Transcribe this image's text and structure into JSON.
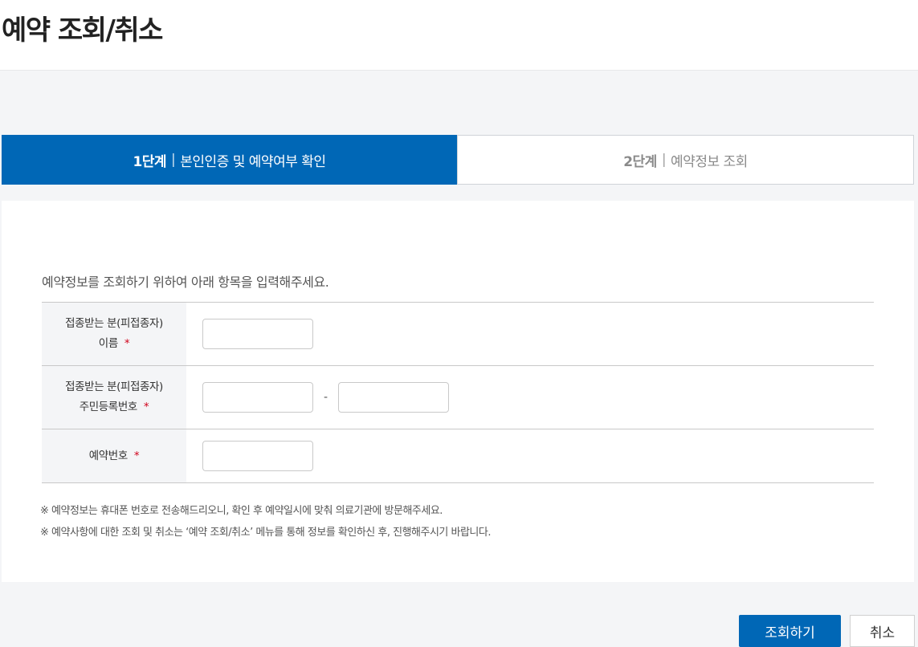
{
  "page": {
    "title": "예약 조회/취소"
  },
  "steps": [
    {
      "number": "1단계",
      "separator": "|",
      "label": "본인인증 및 예약여부 확인",
      "active": true
    },
    {
      "number": "2단계",
      "separator": "|",
      "label": "예약정보 조회",
      "active": false
    }
  ],
  "form": {
    "intro": "예약정보를 조회하기 위하여 아래 항목을 입력해주세요.",
    "rows": [
      {
        "label_line1": "접종받는 분(피접종자)",
        "label_line2": "이름",
        "required_mark": "*",
        "value": ""
      },
      {
        "label_line1": "접종받는 분(피접종자)",
        "label_line2": "주민등록번호",
        "required_mark": "*",
        "value_front": "",
        "separator": "-",
        "value_back": ""
      },
      {
        "label_line1": "예약번호",
        "required_mark": "*",
        "value": ""
      }
    ]
  },
  "notes": [
    "※ 예약정보는 휴대폰 번호로 전송해드리오니, 확인 후 예약일시에 맞춰 의료기관에 방문해주세요.",
    "※ 예약사항에 대한 조회 및 취소는 ‘예약 조회/취소’ 메뉴를 통해 정보를 확인하신 후, 진행해주시기 바랍니다."
  ],
  "buttons": {
    "submit": "조회하기",
    "cancel": "취소"
  },
  "colors": {
    "primary": "#0067b6",
    "required": "#d0021b",
    "background": "#f4f5f7"
  }
}
